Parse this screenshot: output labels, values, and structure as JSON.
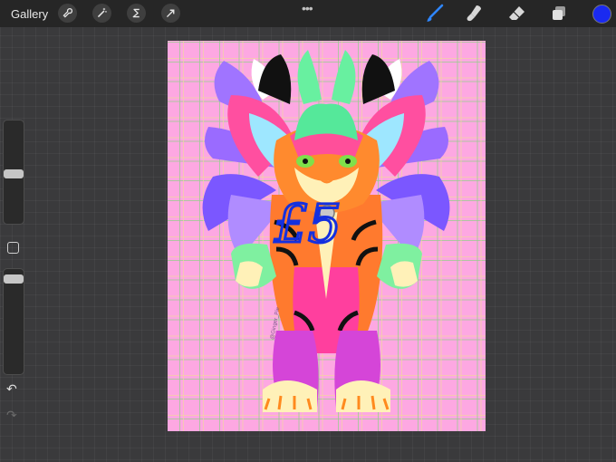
{
  "toolbar": {
    "gallery_label": "Gallery",
    "left_tools": [
      "wrench-icon",
      "magic-wand-icon",
      "selection-icon",
      "transform-arrow-icon"
    ],
    "more_menu": "•••",
    "right_tools": [
      "brush-icon",
      "smudge-icon",
      "eraser-icon",
      "layers-icon"
    ],
    "active_tool": "brush",
    "current_color": "#1a2af0"
  },
  "sidebar": {
    "brush_size_slider": {
      "value": 0.45
    },
    "opacity_slider": {
      "value": 0.05
    },
    "undo_label": "↶",
    "redo_label": "↷"
  },
  "canvas": {
    "artwork_subject": "tiger-creature-character-illustration",
    "background_color": "#fda8e2",
    "grid_colors": [
      "#96cd8c",
      "#f0dc96"
    ],
    "overlay_text": "£5",
    "overlay_color": "#1430e0",
    "signature": "@Ginger_Pie"
  }
}
